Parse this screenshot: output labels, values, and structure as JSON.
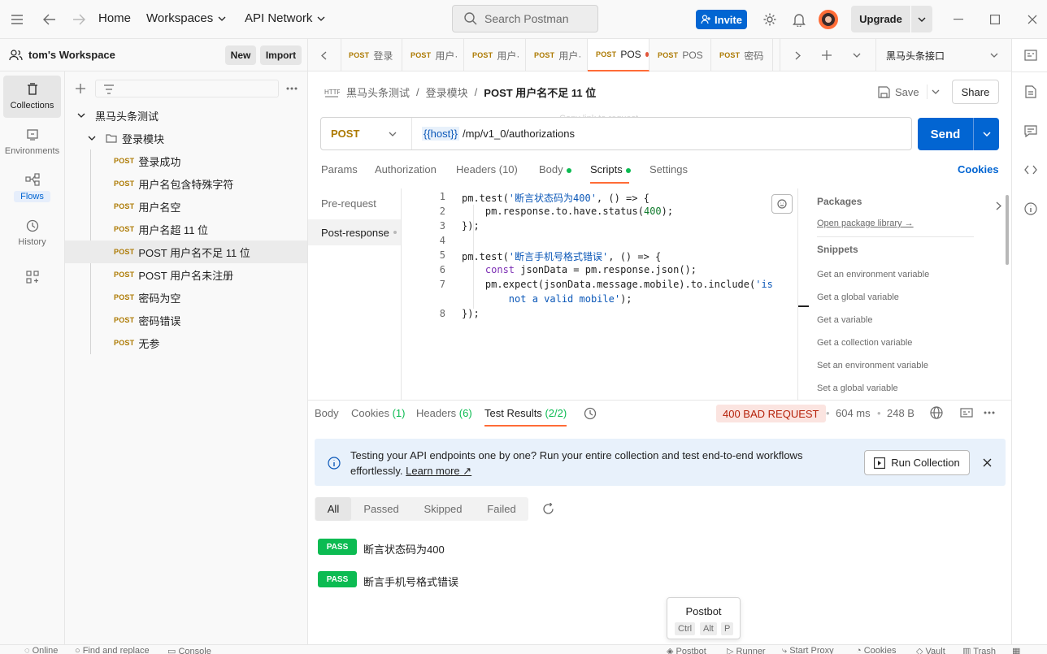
{
  "topbar": {
    "home": "Home",
    "workspaces": "Workspaces",
    "api_network": "API Network",
    "search_placeholder": "Search Postman",
    "invite": "Invite",
    "upgrade": "Upgrade"
  },
  "workspace": {
    "name": "tom's Workspace",
    "new": "New",
    "import": "Import"
  },
  "rail": {
    "collections": "Collections",
    "environments": "Environments",
    "flows": "Flows",
    "history": "History"
  },
  "tree": {
    "collection": "黑马头条测试",
    "folder": "登录模块",
    "method": "POST",
    "requests": [
      "登录成功",
      "用户名包含特殊字符",
      "用户名空",
      "用户名超 11 位",
      "POST 用户名不足 11 位",
      "POST 用户名未注册",
      "密码为空",
      "密码错误",
      "无参"
    ]
  },
  "tabs": [
    {
      "method": "POST",
      "label": "登录"
    },
    {
      "method": "POST",
      "label": "用户·"
    },
    {
      "method": "POST",
      "label": "用户·"
    },
    {
      "method": "POST",
      "label": "用户·"
    },
    {
      "method": "POST",
      "label": "POS"
    },
    {
      "method": "POST",
      "label": "POS"
    },
    {
      "method": "POST",
      "label": "密码"
    }
  ],
  "environment": "黑马头条接口",
  "breadcrumb": {
    "collection": "黑马头条测试",
    "folder": "登录模块",
    "current": "POST 用户名不足 11 位"
  },
  "save": "Save",
  "share": "Share",
  "copy_link_tooltip": "Copy link to request",
  "request": {
    "method": "POST",
    "host_var": "{{host}}",
    "path": "/mp/v1_0/authorizations",
    "send": "Send"
  },
  "req_tabs": {
    "params": "Params",
    "authorization": "Authorization",
    "headers": "Headers (10)",
    "body": "Body",
    "scripts": "Scripts",
    "settings": "Settings",
    "cookies": "Cookies"
  },
  "script_side": {
    "pre": "Pre-request",
    "post": "Post-response"
  },
  "code_lines": [
    "1",
    "2",
    "3",
    "4",
    "5",
    "6",
    "7",
    "8"
  ],
  "packages": {
    "title": "Packages",
    "link": "Open package library →",
    "snippets_title": "Snippets"
  },
  "snippets": [
    "Get an environment variable",
    "Get a global variable",
    "Get a variable",
    "Get a collection variable",
    "Set an environment variable",
    "Set a global variable"
  ],
  "response": {
    "tabs": {
      "body": "Body",
      "cookies": "Cookies",
      "cookies_count": "(1)",
      "headers": "Headers",
      "headers_count": "(6)",
      "tests": "Test Results",
      "tests_count": "(2/2)"
    },
    "status": "400 BAD REQUEST",
    "time": "604 ms",
    "size": "248 B",
    "banner_text": "Testing your API endpoints one by one? Run your entire collection and test end-to-end workflows effortlessly.",
    "learn_more": "Learn more ↗",
    "run_collection": "Run Collection",
    "filters": [
      "All",
      "Passed",
      "Skipped",
      "Failed"
    ],
    "results": [
      {
        "badge": "PASS",
        "name": "断言状态码为400"
      },
      {
        "badge": "PASS",
        "name": "断言手机号格式错误"
      }
    ]
  },
  "postbot": {
    "title": "Postbot",
    "keys": [
      "Ctrl",
      "Alt",
      "P"
    ]
  },
  "statusbar": {
    "online": "Online",
    "find": "Find and replace",
    "console": "Console",
    "postbot": "Postbot",
    "runner": "Runner",
    "proxy": "Start Proxy",
    "cookies": "Cookies",
    "vault": "Vault",
    "trash": "Trash"
  },
  "colors": {
    "accent": "#ff6c37",
    "primary": "#0265d2",
    "pass": "#0cbb52",
    "post": "#ad7a03"
  }
}
